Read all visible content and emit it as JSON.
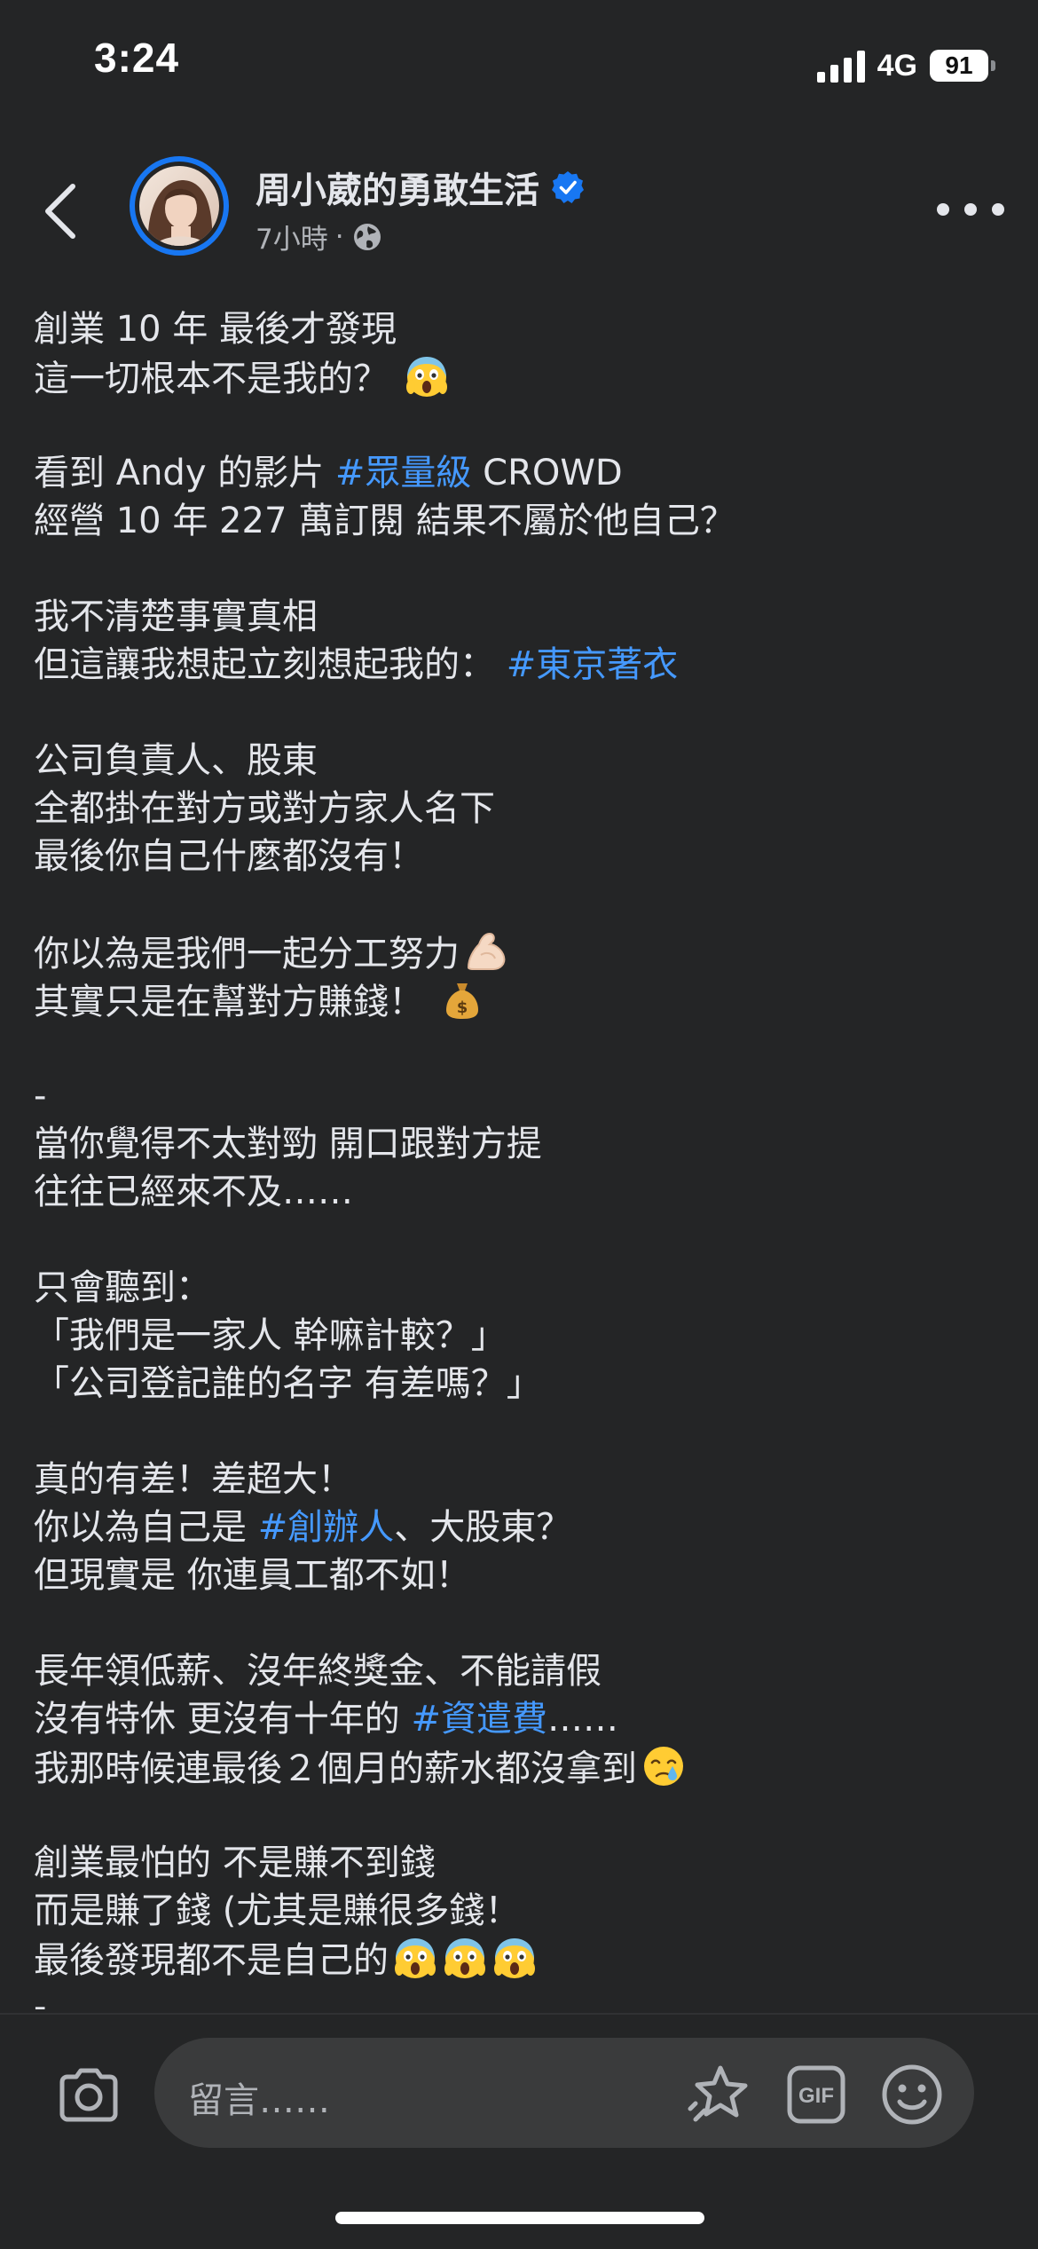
{
  "status_bar": {
    "time": "3:24",
    "network": "4G",
    "battery": "91"
  },
  "post_header": {
    "page_name": "周小葳的勇敢生活",
    "time_ago": "7小時",
    "separator": "·",
    "icons": {
      "back": "chevron-left-icon",
      "verified": "verified-badge-icon",
      "audience": "globe-icon",
      "more": "more-dots-icon"
    },
    "colors": {
      "verified": "#1877f2",
      "avatar_ring": "#1877f2"
    }
  },
  "post": {
    "hashtag_color": "#4599ff",
    "lines": [
      [
        {
          "t": "創業 10 年 最後才發現"
        }
      ],
      [
        {
          "t": "這一切根本不是我的？ "
        },
        {
          "emoji": "scream"
        }
      ],
      [],
      [
        {
          "t": "看到 Andy 的影片 "
        },
        {
          "tag": "#眾量級"
        },
        {
          "t": " CROWD"
        }
      ],
      [
        {
          "t": "經營 10 年 227 萬訂閱 結果不屬於他自己？"
        }
      ],
      [],
      [
        {
          "t": "我不清楚事實真相"
        }
      ],
      [
        {
          "t": "但這讓我想起立刻想起我的： "
        },
        {
          "tag": "#東京著衣"
        }
      ],
      [],
      [
        {
          "t": "公司負責人、股東"
        }
      ],
      [
        {
          "t": "全都掛在對方或對方家人名下"
        }
      ],
      [
        {
          "t": "最後你自己什麼都沒有！"
        }
      ],
      [],
      [
        {
          "t": "你以為是我們一起分工努力"
        },
        {
          "emoji": "muscle"
        }
      ],
      [
        {
          "t": "其實只是在幫對方賺錢！ "
        },
        {
          "emoji": "moneybag"
        }
      ],
      [],
      [
        {
          "t": "-"
        }
      ],
      [
        {
          "t": "當你覺得不太對勁 開口跟對方提"
        }
      ],
      [
        {
          "t": "往往已經來不及……"
        }
      ],
      [],
      [
        {
          "t": "只會聽到："
        }
      ],
      [
        {
          "t": "「我們是一家人 幹嘛計較？」"
        }
      ],
      [
        {
          "t": "「公司登記誰的名字 有差嗎？」"
        }
      ],
      [],
      [
        {
          "t": "真的有差！差超大！"
        }
      ],
      [
        {
          "t": "你以為自己是 "
        },
        {
          "tag": "#創辦人"
        },
        {
          "t": "、大股東？"
        }
      ],
      [
        {
          "t": "但現實是 你連員工都不如！"
        }
      ],
      [],
      [
        {
          "t": "長年領低薪、沒年終獎金、不能請假"
        }
      ],
      [
        {
          "t": "沒有特休 更沒有十年的 "
        },
        {
          "tag": "#資遣費"
        },
        {
          "t": "……"
        }
      ],
      [
        {
          "t": "我那時候連最後２個月的薪水都沒拿到"
        },
        {
          "emoji": "crying"
        }
      ],
      [],
      [
        {
          "t": "創業最怕的 不是賺不到錢"
        }
      ],
      [
        {
          "t": "而是賺了錢 (尤其是賺很多錢！"
        }
      ],
      [
        {
          "t": "最後發現都不是自己的"
        },
        {
          "emoji": "scream"
        },
        {
          "emoji": "scream"
        },
        {
          "emoji": "scream"
        }
      ],
      [
        {
          "t": "-"
        }
      ]
    ]
  },
  "comment_bar": {
    "placeholder": "留言……",
    "gif_label": "GIF",
    "icons": {
      "camera": "camera-icon",
      "sticker": "sticker-icon",
      "gif": "gif-icon",
      "emoji": "smiley-icon"
    }
  }
}
